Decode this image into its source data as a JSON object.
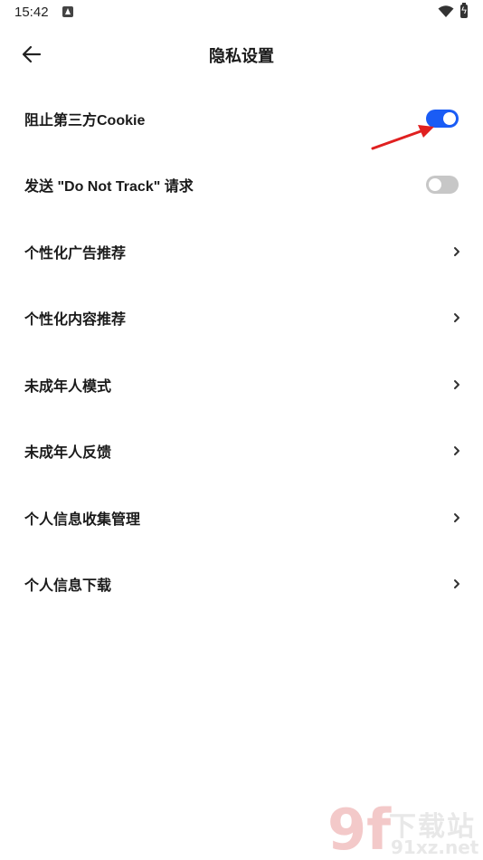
{
  "status_bar": {
    "time": "15:42"
  },
  "header": {
    "title": "隐私设置"
  },
  "settings": [
    {
      "label": "阻止第三方Cookie",
      "control": "toggle",
      "on": true
    },
    {
      "label": "发送 \"Do Not Track\" 请求",
      "control": "toggle",
      "on": false
    },
    {
      "label": "个性化广告推荐",
      "control": "chevron"
    },
    {
      "label": "个性化内容推荐",
      "control": "chevron"
    },
    {
      "label": "未成年人模式",
      "control": "chevron"
    },
    {
      "label": "未成年人反馈",
      "control": "chevron"
    },
    {
      "label": "个人信息收集管理",
      "control": "chevron"
    },
    {
      "label": "个人信息下载",
      "control": "chevron"
    }
  ],
  "watermark": {
    "line1": "下载站",
    "line2": "91xz.net",
    "logo": "9f"
  },
  "colors": {
    "accent": "#1a5cf5",
    "toggle_off": "#c7c7c7",
    "annotation_arrow": "#e02020"
  }
}
